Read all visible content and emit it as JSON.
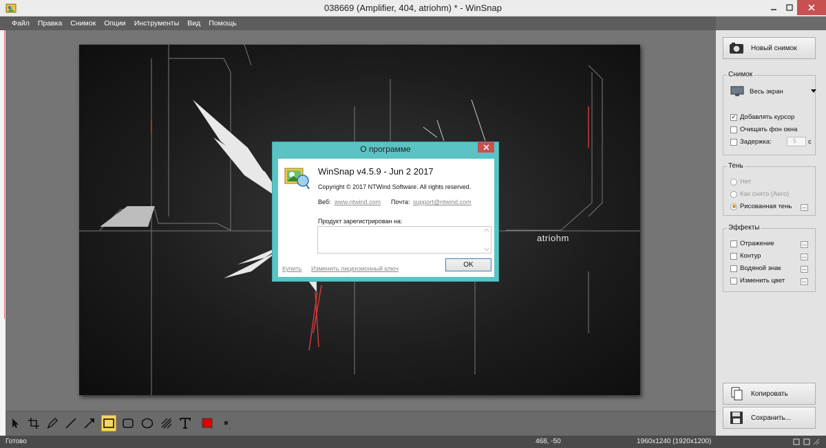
{
  "window": {
    "title": "038669 (Amplifier, 404, atriohm) * - WinSnap"
  },
  "menu": [
    "Файл",
    "Правка",
    "Снимок",
    "Опции",
    "Инструменты",
    "Вид",
    "Помощь"
  ],
  "image": {
    "label": "atriohm"
  },
  "dialog": {
    "title": "О программе",
    "app_name": "WinSnap v4.5.9 - Jun  2 2017",
    "copyright": "Copyright © 2017 NTWind Software. All rights reserved.",
    "web_label": "Веб:",
    "web_value": "www.ntwind.com",
    "mail_label": "Почта:",
    "mail_value": "support@ntwind.com",
    "registered_label": "Продукт зарегистрирован на:",
    "registered_value": "",
    "buy_link": "Купить",
    "change_key_link": "Изменить лицензионный ключ",
    "ok_button": "OK"
  },
  "panel": {
    "new_snapshot": "Новый снимок",
    "snapshot_group": "Снимок",
    "capture_mode": "Весь экран",
    "add_cursor": "Добавлять курсор",
    "clear_bg": "Очищать фон окна",
    "delay": "Задержка:",
    "delay_value": "5",
    "delay_unit": "с",
    "shadow_group": "Тень",
    "shadow_none": "Нет",
    "shadow_aero": "Как снято (Aero)",
    "shadow_drawn": "Рисованная тень",
    "effects_group": "Эффекты",
    "reflection": "Отражение",
    "outline": "Контур",
    "watermark": "Водяной знак",
    "change_color": "Изменить цвет",
    "copy_button": "Копировать",
    "save_button": "Сохранить..."
  },
  "toolbar": {
    "active_tool": "rectangle",
    "color": "#e00000"
  },
  "status": {
    "text": "Готово",
    "coords": "468, -50",
    "dimensions": "1960x1240 (1920x1200)"
  }
}
